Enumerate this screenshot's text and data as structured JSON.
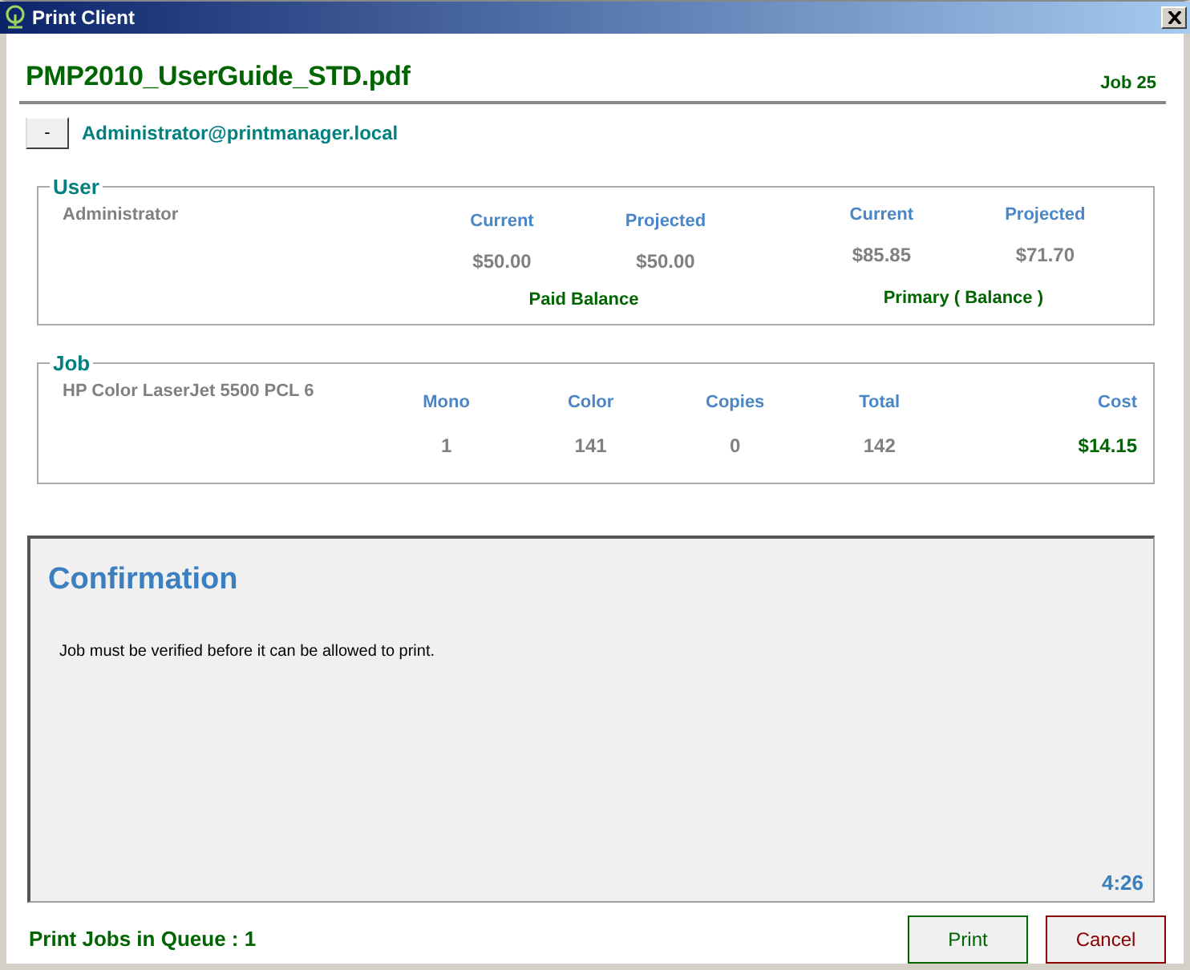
{
  "window": {
    "title": "Print Client"
  },
  "document": {
    "name": "PMP2010_UserGuide_STD.pdf",
    "job": "Job 25"
  },
  "account": {
    "toggle": "-",
    "email": "Administrator@printmanager.local"
  },
  "user": {
    "legend": "User",
    "name": "Administrator",
    "balances": [
      {
        "label": "Paid Balance",
        "columns": [
          {
            "heading": "Current",
            "value": "$50.00"
          },
          {
            "heading": "Projected",
            "value": "$50.00"
          }
        ]
      },
      {
        "label": "Primary ( Balance )",
        "columns": [
          {
            "heading": "Current",
            "value": "$85.85"
          },
          {
            "heading": "Projected",
            "value": "$71.70"
          }
        ]
      }
    ]
  },
  "job": {
    "legend": "Job",
    "printer": "HP Color LaserJet 5500 PCL 6",
    "columns": [
      {
        "heading": "Mono",
        "value": "1",
        "kind": "count"
      },
      {
        "heading": "Color",
        "value": "141",
        "kind": "count"
      },
      {
        "heading": "Copies",
        "value": "0",
        "kind": "count"
      },
      {
        "heading": "Total",
        "value": "142",
        "kind": "count"
      },
      {
        "heading": "Cost",
        "value": "$14.15",
        "kind": "cost"
      }
    ]
  },
  "confirmation": {
    "title": "Confirmation",
    "message": "Job must be verified before it can be allowed to print.",
    "timer": "4:26"
  },
  "status": "Print Jobs in Queue : 1",
  "buttons": [
    {
      "label": "Print",
      "kind": "confirm"
    },
    {
      "label": "Cancel",
      "kind": "cancel"
    }
  ]
}
